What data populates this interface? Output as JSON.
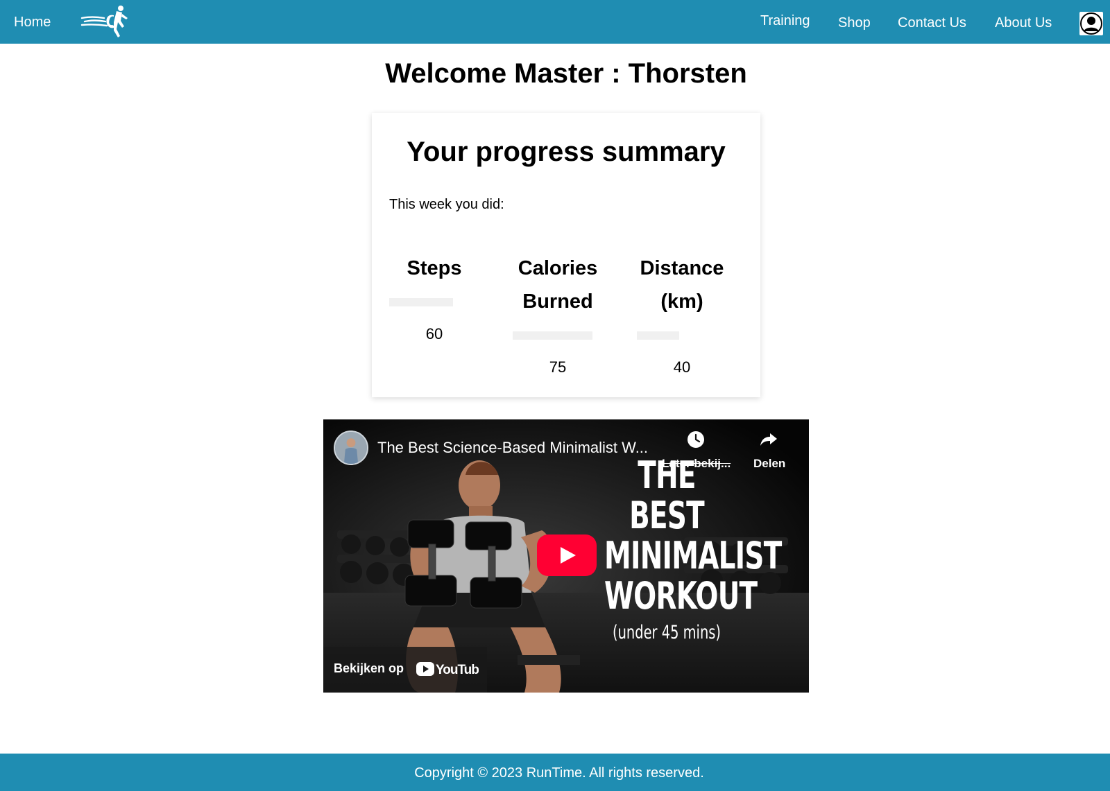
{
  "nav": {
    "home": "Home",
    "links": [
      "Training",
      "Shop",
      "Contact Us",
      "About Us"
    ]
  },
  "main": {
    "welcome": "Welcome Master : Thorsten",
    "card": {
      "title": "Your progress summary",
      "subtitle": "This week you did:",
      "stats": [
        {
          "label_line1": "Steps",
          "label_line2": "",
          "value": "60",
          "progress": 0.6
        },
        {
          "label_line1": "Calories",
          "label_line2": "Burned",
          "value": "75",
          "progress": 0.75
        },
        {
          "label_line1": "Distance",
          "label_line2": "(km)",
          "value": "40",
          "progress": 0.4
        }
      ]
    },
    "video": {
      "title": "The Best Science-Based Minimalist W...",
      "watch_later": "Later bekij...",
      "share": "Delen",
      "headline_1": "THE BEST",
      "headline_2": "MINIMALIST",
      "headline_3": "WORKOUT",
      "headline_4": "(under 45 mins)",
      "watch_on": "Bekijken op",
      "youtube": "YouTube"
    }
  },
  "footer": {
    "copyright": "Copyright © 2023 RunTime. All rights reserved."
  },
  "colors": {
    "brand": "#1f8db2",
    "youtube_red": "#ff0033"
  },
  "icons": [
    "runner-logo-icon",
    "user-avatar-icon",
    "clock-icon",
    "share-arrow-icon",
    "play-icon",
    "youtube-logo-icon"
  ]
}
